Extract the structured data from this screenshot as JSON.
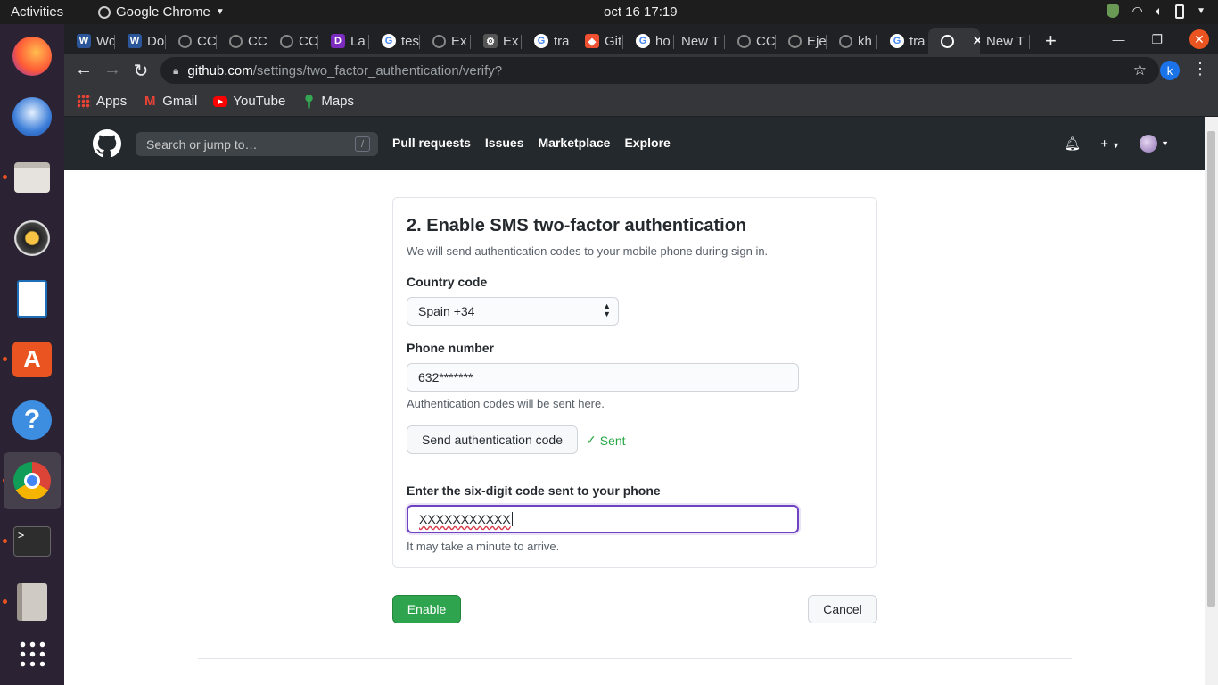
{
  "topbar": {
    "activities": "Activities",
    "app_name": "Google Chrome",
    "clock": "oct 16  17:19"
  },
  "tabs": [
    {
      "label": "Wo",
      "favicon": "word-icon",
      "color": "#2b579a",
      "glyph": "W"
    },
    {
      "label": "Do",
      "favicon": "word-icon",
      "color": "#2b579a",
      "glyph": "W"
    },
    {
      "label": "CC",
      "favicon": "github-icon",
      "color": "#444",
      "glyph": ""
    },
    {
      "label": "CC",
      "favicon": "github-icon",
      "color": "#444",
      "glyph": ""
    },
    {
      "label": "CC",
      "favicon": "github-icon",
      "color": "#444",
      "glyph": ""
    },
    {
      "label": "La",
      "favicon": "app-icon",
      "color": "#7b2cbf",
      "glyph": "D"
    },
    {
      "label": "tes",
      "favicon": "google-icon",
      "color": "#fff",
      "glyph": "G"
    },
    {
      "label": "Ex",
      "favicon": "github-icon",
      "color": "#444",
      "glyph": ""
    },
    {
      "label": "Ex",
      "favicon": "gear-icon",
      "color": "#555",
      "glyph": "⚙"
    },
    {
      "label": "tra",
      "favicon": "google-icon",
      "color": "#fff",
      "glyph": "G"
    },
    {
      "label": "Git",
      "favicon": "git-icon",
      "color": "#f05032",
      "glyph": "◆"
    },
    {
      "label": "ho",
      "favicon": "google-icon",
      "color": "#fff",
      "glyph": "G"
    },
    {
      "label": "New T",
      "favicon": "",
      "color": "",
      "glyph": ""
    },
    {
      "label": "CC",
      "favicon": "github-icon",
      "color": "#444",
      "glyph": ""
    },
    {
      "label": "Eje",
      "favicon": "github-icon",
      "color": "#444",
      "glyph": ""
    },
    {
      "label": "kh",
      "favicon": "github-icon",
      "color": "#444",
      "glyph": ""
    },
    {
      "label": "tra",
      "favicon": "google-icon",
      "color": "#fff",
      "glyph": "G"
    },
    {
      "label": "",
      "favicon": "github-icon",
      "color": "#fff",
      "glyph": ""
    },
    {
      "label": "New T",
      "favicon": "",
      "color": "",
      "glyph": ""
    }
  ],
  "omnibox": {
    "host": "github.com",
    "path": "/settings/two_factor_authentication/verify?"
  },
  "profile_initial": "k",
  "bookmarks": [
    {
      "label": "Apps",
      "icon": "apps-grid-icon"
    },
    {
      "label": "Gmail",
      "icon": "gmail-icon"
    },
    {
      "label": "YouTube",
      "icon": "youtube-icon"
    },
    {
      "label": "Maps",
      "icon": "maps-icon"
    }
  ],
  "github": {
    "search_placeholder": "Search or jump to…",
    "search_shortcut": "/",
    "nav": [
      "Pull requests",
      "Issues",
      "Marketplace",
      "Explore"
    ]
  },
  "form": {
    "title": "2. Enable SMS two-factor authentication",
    "subtitle": "We will send authentication codes to your mobile phone during sign in.",
    "country_label": "Country code",
    "country_value": "Spain +34",
    "phone_label": "Phone number",
    "phone_value": "632*******",
    "phone_note": "Authentication codes will be sent here.",
    "send_button": "Send authentication code",
    "sent_status": "Sent",
    "code_label": "Enter the six-digit code sent to your phone",
    "code_value": "XXXXXXXXXXX",
    "code_note": "It may take a minute to arrive.",
    "enable_button": "Enable",
    "cancel_button": "Cancel"
  },
  "colors": {
    "accent_green": "#2ea44f",
    "focus_purple": "#6f42c1",
    "ubuntu_orange": "#e95420"
  }
}
